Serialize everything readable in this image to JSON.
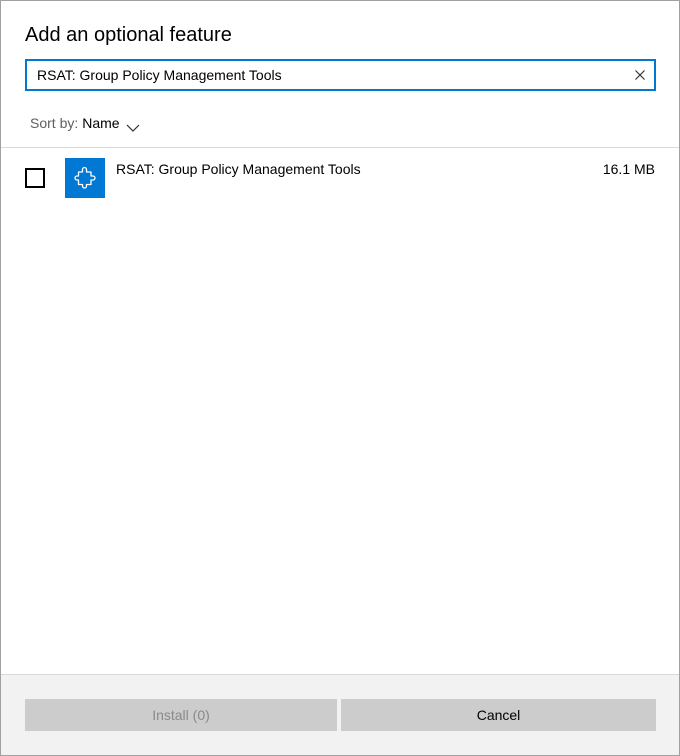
{
  "dialog": {
    "title": "Add an optional feature"
  },
  "search": {
    "value": "RSAT: Group Policy Management Tools",
    "clear_icon": "close-icon"
  },
  "sort": {
    "label": "Sort by:",
    "value": "Name",
    "icon": "chevron-down-icon"
  },
  "features": [
    {
      "name": "RSAT: Group Policy Management Tools",
      "size": "16.1 MB",
      "checked": false,
      "icon": "puzzle-piece-icon"
    }
  ],
  "footer": {
    "install_label": "Install (0)",
    "cancel_label": "Cancel"
  },
  "colors": {
    "accent": "#0078d4",
    "footer_bg": "#f2f2f2",
    "button_bg": "#cccccc",
    "disabled_text": "#8a8a8a"
  }
}
